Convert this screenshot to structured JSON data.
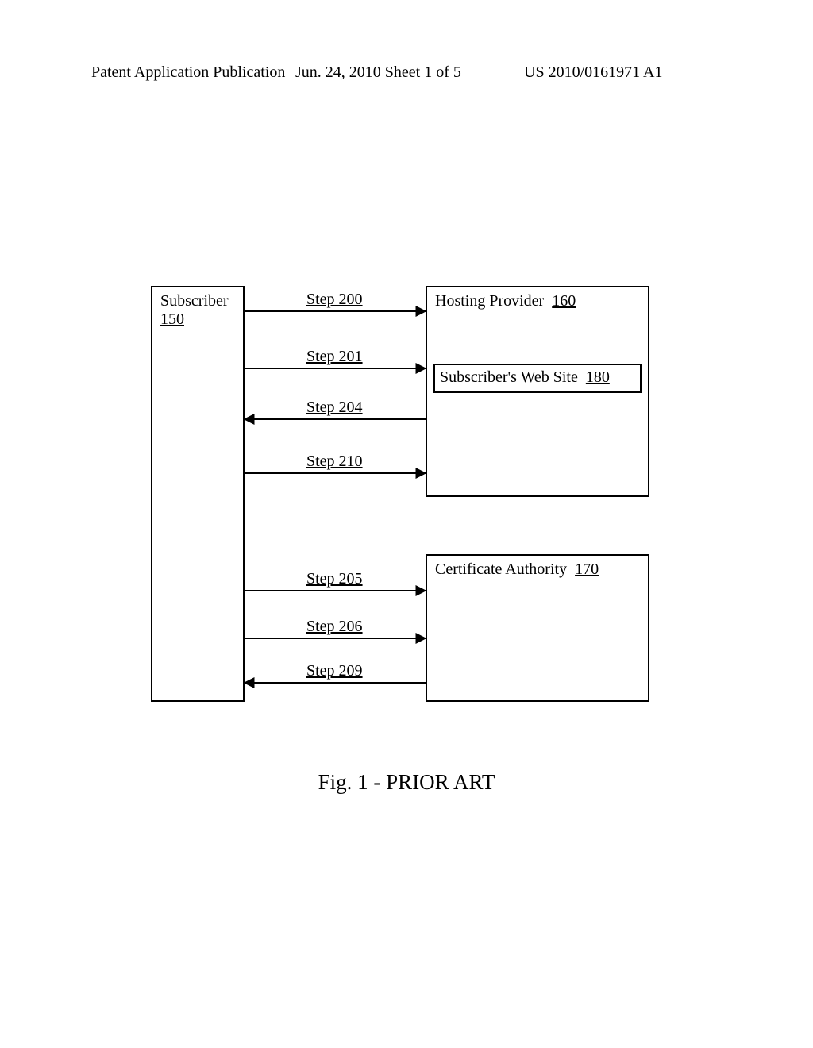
{
  "header": {
    "left": "Patent Application Publication",
    "center": "Jun. 24, 2010  Sheet 1 of 5",
    "right": "US 2010/0161971 A1"
  },
  "entities": {
    "subscriber": {
      "label": "Subscriber",
      "ref": "150"
    },
    "hosting": {
      "label": "Hosting Provider",
      "ref": "160"
    },
    "website": {
      "label": "Subscriber's Web Site",
      "ref": "180"
    },
    "ca": {
      "label": "Certificate Authority",
      "ref": "170"
    }
  },
  "steps": {
    "s200": "Step 200",
    "s201": "Step 201",
    "s204": "Step 204",
    "s210": "Step 210",
    "s205": "Step 205",
    "s206": "Step 206",
    "s209": "Step 209"
  },
  "caption": "Fig. 1 - PRIOR ART",
  "chart_data": {
    "type": "sequence-diagram",
    "lifelines": [
      {
        "id": "subscriber",
        "name": "Subscriber",
        "ref": "150"
      },
      {
        "id": "hosting",
        "name": "Hosting Provider",
        "ref": "160",
        "contains": [
          {
            "id": "website",
            "name": "Subscriber's Web Site",
            "ref": "180"
          }
        ]
      },
      {
        "id": "ca",
        "name": "Certificate Authority",
        "ref": "170"
      }
    ],
    "messages": [
      {
        "label": "Step 200",
        "from": "subscriber",
        "to": "hosting"
      },
      {
        "label": "Step 201",
        "from": "subscriber",
        "to": "hosting"
      },
      {
        "label": "Step 204",
        "from": "hosting",
        "to": "subscriber"
      },
      {
        "label": "Step 210",
        "from": "subscriber",
        "to": "hosting"
      },
      {
        "label": "Step 205",
        "from": "subscriber",
        "to": "ca"
      },
      {
        "label": "Step 206",
        "from": "subscriber",
        "to": "ca"
      },
      {
        "label": "Step 209",
        "from": "ca",
        "to": "subscriber"
      }
    ]
  }
}
